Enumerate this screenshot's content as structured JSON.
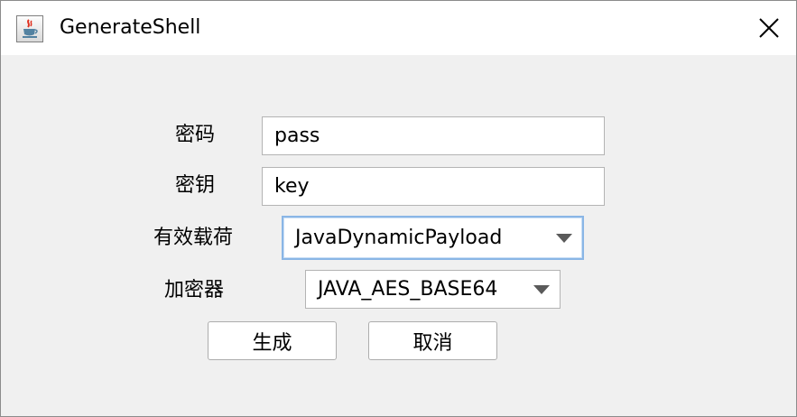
{
  "window": {
    "title": "GenerateShell",
    "icon": "java-cup-icon",
    "close_icon": "close-icon"
  },
  "form": {
    "password": {
      "label": "密码",
      "value": "pass"
    },
    "secret_key": {
      "label": "密钥",
      "value": "key"
    },
    "payload": {
      "label": "有效载荷",
      "selected": "JavaDynamicPayload"
    },
    "cryption": {
      "label": "加密器",
      "selected": "JAVA_AES_BASE64"
    }
  },
  "buttons": {
    "generate": "生成",
    "cancel": "取消"
  },
  "colors": {
    "focus_border": "#8ab6e6",
    "panel_bg": "#f0f0f0",
    "arrow": "#5a5a5a"
  }
}
